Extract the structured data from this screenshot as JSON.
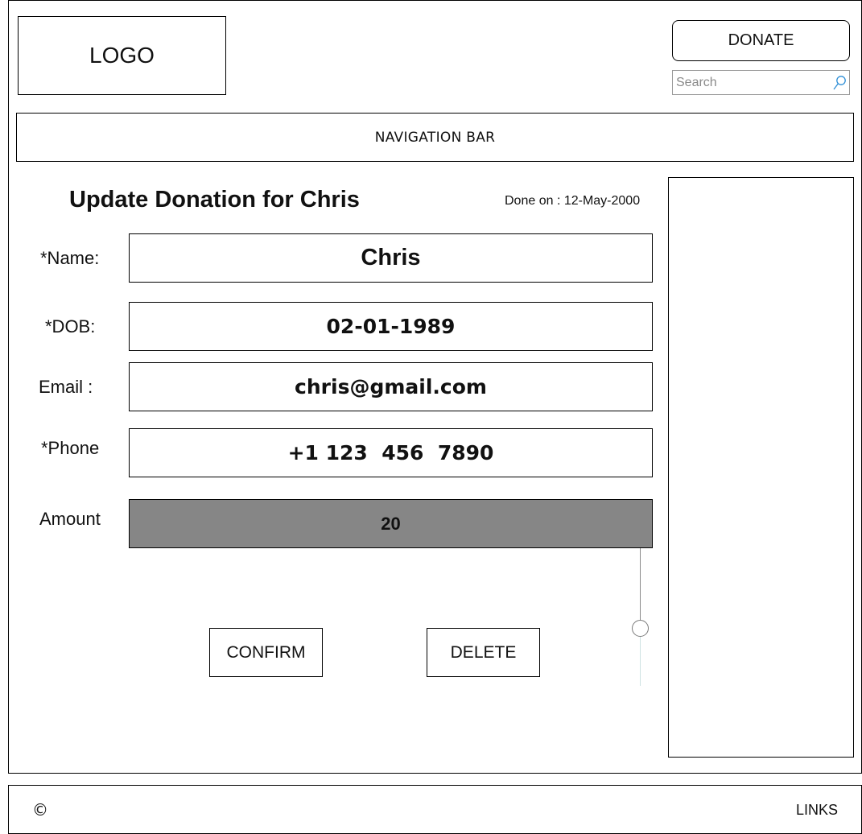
{
  "header": {
    "logo_text": "LOGO",
    "donate_label": "DONATE",
    "search_placeholder": "Search",
    "search_value": "",
    "search_icon": "search-icon"
  },
  "nav": {
    "label": "NAVIGATION BAR"
  },
  "form": {
    "title": "Update Donation for Chris",
    "done_on": "Done on : 12-May-2000",
    "fields": {
      "name": {
        "label": "*Name:",
        "value": "Chris"
      },
      "dob": {
        "label": "*DOB:",
        "value": "02-01-1989"
      },
      "email": {
        "label": "Email :",
        "value": "chris@gmail.com"
      },
      "phone": {
        "label": "*Phone",
        "value": "+1 123  456  7890"
      },
      "amount": {
        "label": "Amount",
        "value": "20"
      }
    },
    "confirm_label": "CONFIRM",
    "delete_label": "DELETE"
  },
  "footer": {
    "copyright": "©",
    "links_label": "LINKS"
  },
  "colors": {
    "amount_fill": "#868686",
    "border": "#000000",
    "search_icon": "#2f8fd6"
  }
}
